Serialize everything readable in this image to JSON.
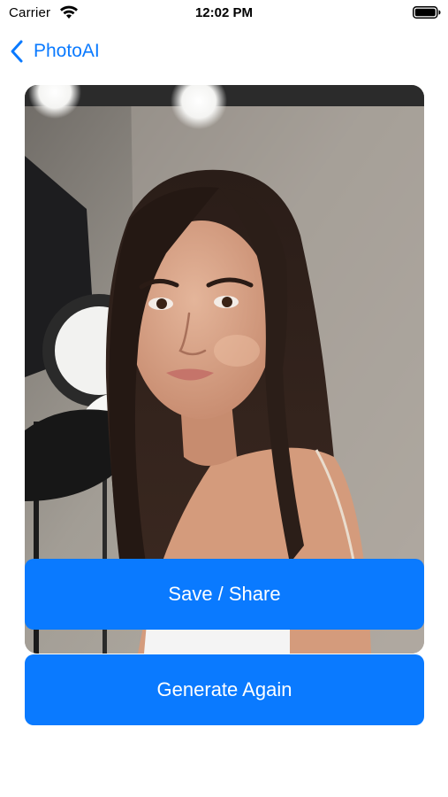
{
  "status_bar": {
    "carrier": "Carrier",
    "time": "12:02 PM",
    "wifi_icon": "wifi-icon",
    "battery_icon": "battery-icon"
  },
  "nav": {
    "back_label": "PhotoAI",
    "back_icon": "chevron-left-icon"
  },
  "photo": {
    "alt": "Generated portrait photo"
  },
  "actions": {
    "save_label": "Save / Share",
    "generate_label": "Generate Again"
  },
  "colors": {
    "accent": "#0a7aff",
    "background": "#ffffff"
  }
}
